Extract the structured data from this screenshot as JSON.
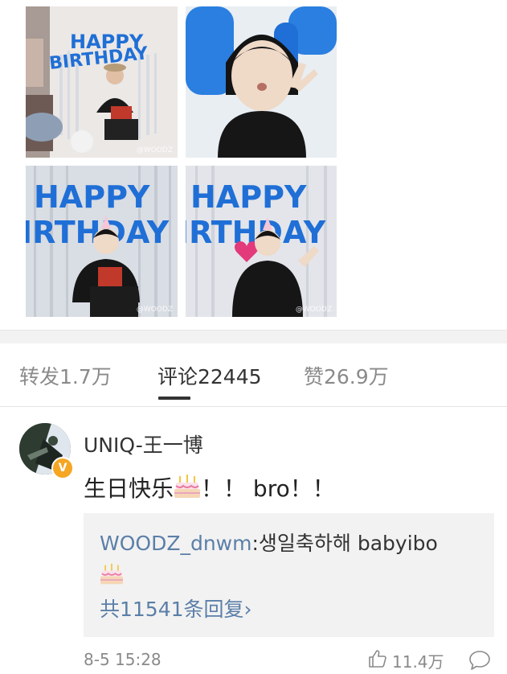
{
  "photos": {
    "watermark": "@WOODZ",
    "banner_line1": "HAPPY",
    "banner_line2": "BIRTHDAY",
    "colors": {
      "balloon": "#1f6fd6",
      "curtain": "#d9dde4",
      "shirt": "#1a1a1a"
    }
  },
  "tabs": [
    {
      "label": "转发1.7万",
      "active": false
    },
    {
      "label": "评论22445",
      "active": true
    },
    {
      "label": "赞26.9万",
      "active": false
    }
  ],
  "comment": {
    "username": "UNIQ-王一博",
    "badge": "V",
    "text_before": "生日快乐",
    "text_after": "！！ bro！！",
    "emoji_icon": "birthday-cake-icon",
    "reply": {
      "user": "WOODZ_dnwm",
      "separator": ":",
      "text": "생일축하해 babyibo",
      "more": "共11541条回复",
      "more_chevron": "›"
    },
    "timestamp": "8-5 15:28",
    "like_count": "11.4万"
  },
  "colors": {
    "link": "#5b7fa8",
    "badge": "#f5a623",
    "text_muted": "#8a8a8a"
  }
}
